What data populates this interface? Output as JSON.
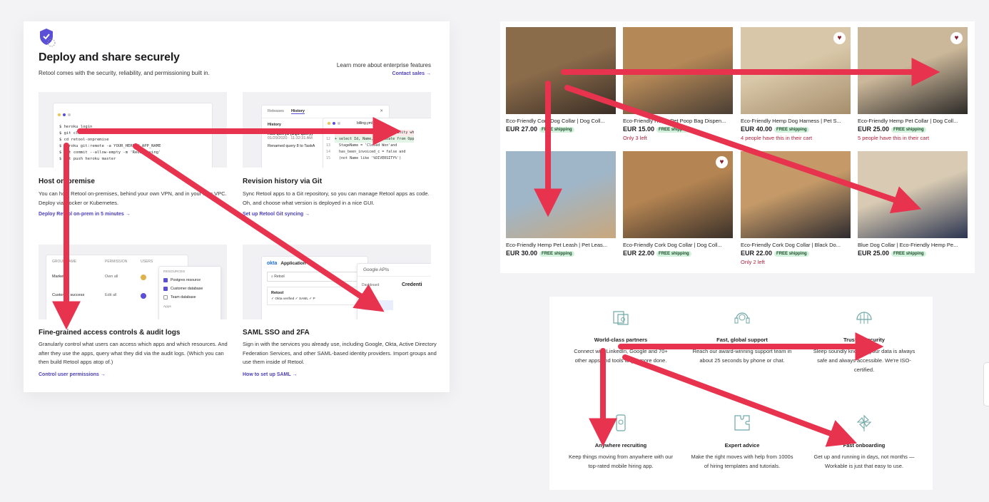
{
  "retool": {
    "title": "Deploy and share securely",
    "subtitle": "Retool comes with the security, reliability, and permissioning built in.",
    "learn_more": "Learn more about enterprise features",
    "contact_sales": "Contact sales →",
    "cards": [
      {
        "title": "Host on-premise",
        "desc": "You can host Retool on-premises, behind your own VPN, and in your own VPC. Deploy via Docker or Kubernetes.",
        "link": "Deploy Retool on-prem in 5 minutes →",
        "code": [
          "$ heroku login",
          "$ git clone",
          "$ cd retool-onpremise",
          "$ heroku git:remote -a YOUR_HEROKU_APP_NAME",
          "",
          "$ git commit --allow-empty -m 'Redeploying'",
          "$ git push heroku master"
        ]
      },
      {
        "title": "Revision history via Git",
        "desc": "Sync Retool apps to a Git repository, so you can manage Retool apps as code. Oh, and choose what version is deployed in a nice GUI.",
        "link": "Set up Retool Git syncing →",
        "tabs": [
          "Releases",
          "History"
        ],
        "history_label": "History",
        "entry1": "Add query2 (SQL query)",
        "entry1_time": "01/29/2020 · 11:32:31 AM",
        "entry2": "Renamed query 8 to TaskA",
        "filename": "billing.yml",
        "diff": [
          "- select Id, Name from Opportunity wh",
          "+ select Id, Name, CloseDate from Opp",
          "  StageName = 'Closed Won'and",
          "  has_been_invoiced_c = false and",
          "  (not Name like '%DIVERSITY%')"
        ],
        "diff_nums": [
          "11",
          "12",
          "13",
          "14",
          "15"
        ]
      },
      {
        "title": "Fine-grained access controls & audit logs",
        "desc": "Granularly control what users can access which apps and which resources. And after they use the apps, query what they did via the audit logs. (Which you can then build Retool apps atop of.)",
        "link": "Control user permissions →",
        "cols": [
          "GROUP NAME",
          "PERMISSION",
          "USERS"
        ],
        "rows": [
          {
            "name": "Marketing",
            "perm": "Own all"
          },
          {
            "name": "Customer success",
            "perm": "Edit all"
          }
        ],
        "resources_label": "RESOURCES",
        "resources": [
          "Postgres resource",
          "Customer database",
          "Team database"
        ],
        "apps_label": "Apps"
      },
      {
        "title": "SAML SSO and 2FA",
        "desc": "Sign in with the services you already use, including Google, Okta, Active Directory Federation Services, and other SAML-based identity providers. Import groups and use them inside of Retool.",
        "link": "How to set up SAML →",
        "okta": "okta",
        "okta_app": "Application",
        "okta_search": "Retool",
        "okta_item": "Retool",
        "okta_badges": "✓ Okta verified  ✓ SAML  ✓ P",
        "gapi_title": "Google APIs",
        "gapi_items": [
          "Dashboard",
          "Library",
          "Credentials"
        ],
        "credentials": "Credenti"
      }
    ]
  },
  "shop": {
    "products": [
      {
        "name": "Eco-Friendly Cork Dog Collar | Dog Coll...",
        "price": "EUR 27.00",
        "free": "FREE shipping",
        "note": "",
        "heart": false,
        "colors": [
          "#8a6b4a",
          "#3a2e26"
        ]
      },
      {
        "name": "Eco-Friendly Hemp Pet Poop Bag Dispen...",
        "price": "EUR 15.00",
        "free": "FREE shipping",
        "note": "Only 3 left",
        "heart": false,
        "colors": [
          "#b48857",
          "#4a3e34"
        ]
      },
      {
        "name": "Eco-Friendly Hemp Dog Harness | Pet S...",
        "price": "EUR 40.00",
        "free": "FREE shipping",
        "note": "4 people have this in their cart",
        "heart": true,
        "colors": [
          "#d8c7a8",
          "#a68e6c"
        ]
      },
      {
        "name": "Eco-Friendly Hemp Pet Collar | Dog Coll...",
        "price": "EUR 25.00",
        "free": "FREE shipping",
        "note": "5 people have this in their cart",
        "heart": true,
        "colors": [
          "#cbb799",
          "#2c2a28"
        ]
      },
      {
        "name": "Eco-Friendly Hemp Pet Leash | Pet Leas...",
        "price": "EUR 30.00",
        "free": "FREE shipping",
        "note": "",
        "heart": false,
        "colors": [
          "#9fb6c9",
          "#c9a77c"
        ]
      },
      {
        "name": "Eco-Friendly Cork Dog Collar | Dog Coll...",
        "price": "EUR 22.00",
        "free": "FREE shipping",
        "note": "",
        "heart": true,
        "colors": [
          "#b48452",
          "#3b3129"
        ]
      },
      {
        "name": "Eco-Friendly Cork Dog Collar | Black Do...",
        "price": "EUR 22.00",
        "free": "FREE shipping",
        "note": "Only 2 left",
        "heart": false,
        "colors": [
          "#c59a68",
          "#2d2a2e"
        ]
      },
      {
        "name": "Blue Dog Collar | Eco-Friendly Hemp Pe...",
        "price": "EUR 25.00",
        "free": "FREE shipping",
        "note": "",
        "heart": false,
        "colors": [
          "#d9cbb3",
          "#2b3550"
        ]
      }
    ]
  },
  "workable": {
    "features": [
      {
        "icon": "partners-icon",
        "title": "World-class partners",
        "desc": "Connect with LinkedIn, Google and 70+ other apps and tools to get more done."
      },
      {
        "icon": "headset-icon",
        "title": "Fast, global support",
        "desc": "Reach our award-winning support team in about 25 seconds by phone or chat."
      },
      {
        "icon": "security-icon",
        "title": "Trusted security",
        "desc": "Sleep soundly knowing your data is always safe and always accessible. We're ISO-certified."
      },
      {
        "icon": "mobile-icon",
        "title": "Anywhere recruiting",
        "desc": "Keep things moving from anywhere with our top-rated mobile hiring app."
      },
      {
        "icon": "puzzle-icon",
        "title": "Expert advice",
        "desc": "Make the right moves with help from 1000s of hiring templates and tutorials."
      },
      {
        "icon": "pinwheel-icon",
        "title": "Fast onboarding",
        "desc": "Get up and running in days, not months — Workable is just that easy to use."
      }
    ]
  },
  "colors": {
    "arrow": "#e8334f",
    "link": "#4b3fbf",
    "free_bg": "#d2f1dc",
    "note": "#b0223c",
    "icon_teal": "#6fa8a6"
  }
}
